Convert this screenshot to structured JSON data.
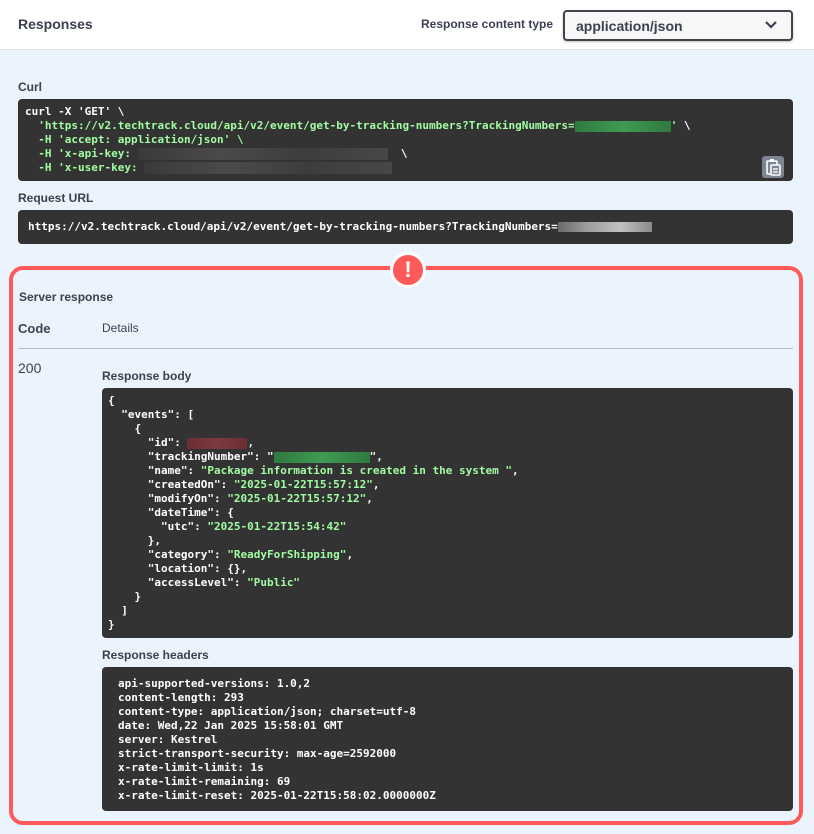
{
  "header": {
    "title": "Responses",
    "content_type_label": "Response content type",
    "content_type_value": "application/json"
  },
  "curl": {
    "label": "Curl",
    "line1": "curl -X 'GET' \\",
    "line2_prefix": "  'https://v2.techtrack.cloud/api/v2/event/get-by-tracking-numbers?TrackingNumbers=",
    "line2_suffix": "' \\",
    "line3": "  -H 'accept: application/json' \\",
    "line4_prefix": "  -H 'x-api-key: ",
    "line4_suffix": "\\",
    "line5_prefix": "  -H 'x-user-key: "
  },
  "request_url": {
    "label": "Request URL",
    "value": "https://v2.techtrack.cloud/api/v2/event/get-by-tracking-numbers?TrackingNumbers="
  },
  "server_response": {
    "label": "Server response",
    "code_header": "Code",
    "details_header": "Details",
    "code": "200",
    "body_label": "Response body",
    "body": {
      "open": "{",
      "events_key": "  \"events\": [",
      "obj_open": "    {",
      "id_key": "      \"id\": ",
      "id_suffix": ",",
      "tracking_key": "      \"trackingNumber\": \"",
      "tracking_suffix": "\",",
      "name_key": "      \"name\": ",
      "name_val": "\"Package information is created in the system \"",
      "created_key": "      \"createdOn\": ",
      "created_val": "\"2025-01-22T15:57:12\"",
      "modify_key": "      \"modifyOn\": ",
      "modify_val": "\"2025-01-22T15:57:12\"",
      "datetime_key": "      \"dateTime\": {",
      "utc_key": "        \"utc\": ",
      "utc_val": "\"2025-01-22T15:54:42\"",
      "datetime_close": "      },",
      "category_key": "      \"category\": ",
      "category_val": "\"ReadyForShipping\"",
      "location_key": "      \"location\": {},",
      "access_key": "      \"accessLevel\": ",
      "access_val": "\"Public\"",
      "obj_close": "    }",
      "arr_close": "  ]",
      "close": "}"
    },
    "headers_label": "Response headers",
    "headers": [
      "api-supported-versions: 1.0,2",
      "content-length: 293",
      "content-type: application/json; charset=utf-8",
      "date: Wed,22 Jan 2025 15:58:01 GMT",
      "server: Kestrel",
      "strict-transport-security: max-age=2592000",
      "x-rate-limit-limit: 1s",
      "x-rate-limit-remaining: 69",
      "x-rate-limit-reset: 2025-01-22T15:58:02.0000000Z"
    ]
  },
  "icons": {
    "dropdown": "chevron-down-icon",
    "copy": "clipboard-copy-icon",
    "alert": "exclamation-alert-icon"
  },
  "colors": {
    "highlight_border": "#ff5a5a",
    "code_bg": "#333333",
    "string": "#a2fca2"
  }
}
